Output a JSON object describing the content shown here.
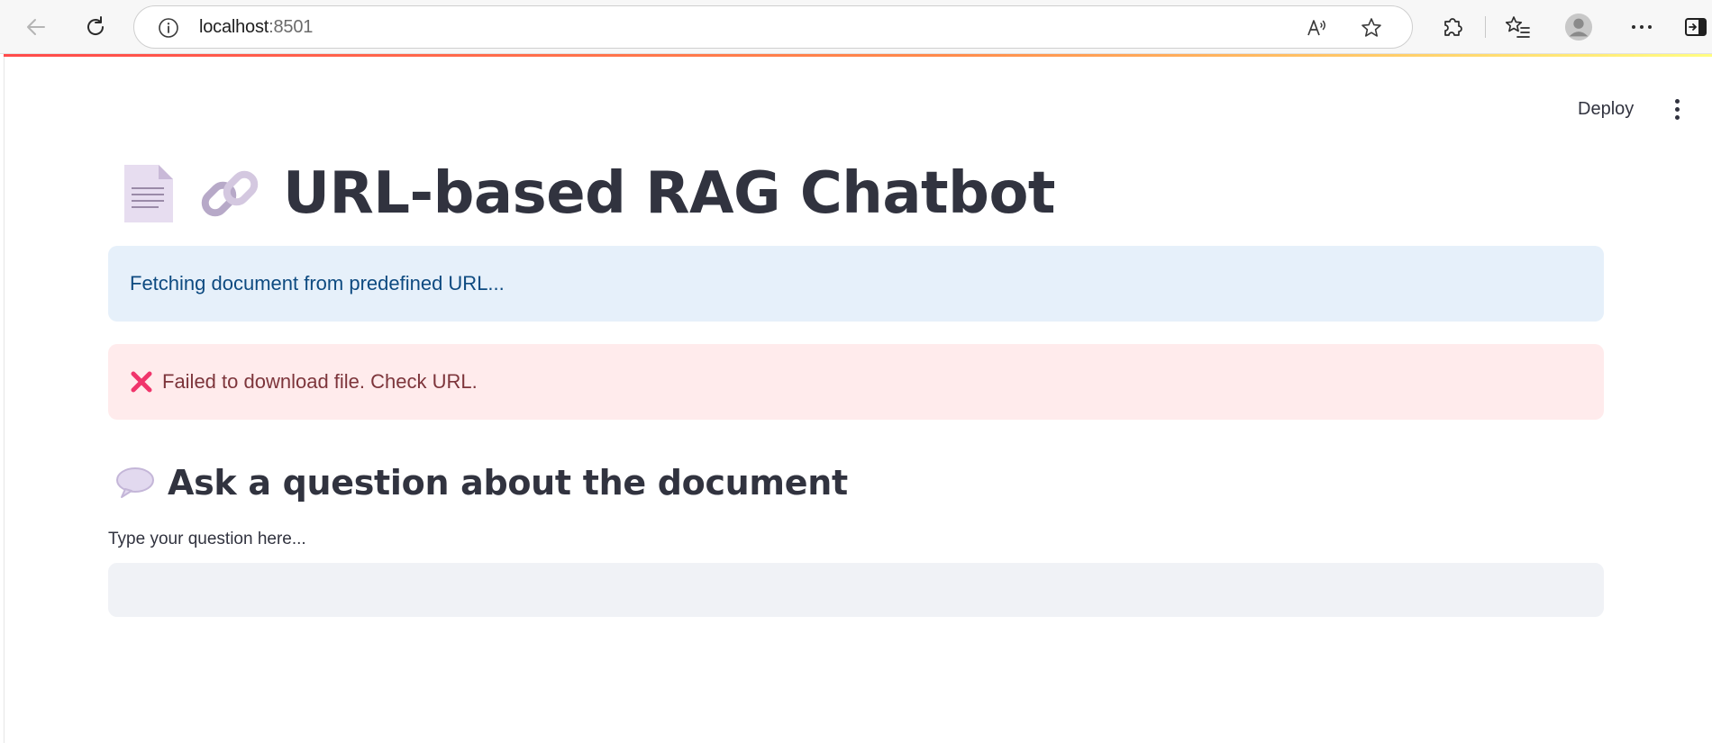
{
  "browser": {
    "url_host": "localhost",
    "url_port": ":8501",
    "icons": {
      "back": "back-arrow-icon",
      "reload": "reload-icon",
      "info": "info-icon",
      "read_aloud": "read-aloud-icon",
      "favorite": "star-icon",
      "extensions": "puzzle-icon",
      "favorites": "favorites-list-icon",
      "profile": "profile-avatar-icon",
      "more": "more-dots-icon",
      "sidebar": "sidebar-toggle-icon"
    }
  },
  "toolbar": {
    "deploy_label": "Deploy"
  },
  "main": {
    "title": "URL-based RAG Chatbot",
    "info_message": "Fetching document from predefined URL...",
    "error_message": "Failed to download file. Check URL.",
    "subheader": "Ask a question about the document",
    "question_label": "Type your question here...",
    "question_value": ""
  },
  "colors": {
    "accent_gradient_start": "#ff4b4b",
    "accent_gradient_end": "#fffd80",
    "info_bg": "#e6f0fa",
    "info_text": "#0d4a80",
    "error_bg": "#ffebec",
    "error_text": "#7d353b",
    "error_icon": "#ff2b6b",
    "text": "#31333f",
    "input_bg": "#f0f2f6"
  }
}
